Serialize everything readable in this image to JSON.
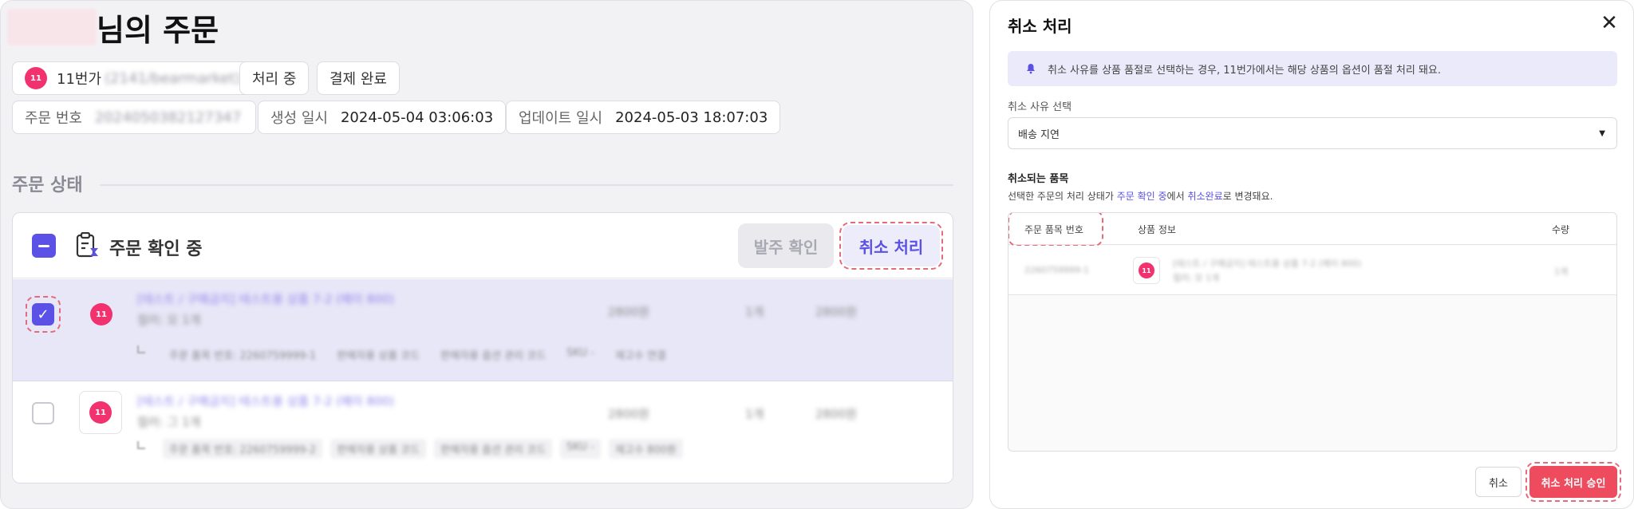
{
  "order_page": {
    "title_suffix": "님의 주문",
    "channel": {
      "name": "11번가",
      "account": "(2141/bearmarket)"
    },
    "status_chips": [
      "처리 중",
      "결제 완료"
    ],
    "order_no": {
      "label": "주문 번호",
      "value": "2024050382127347"
    },
    "created": {
      "label": "생성 일시",
      "value": "2024-05-04 03:06:03"
    },
    "updated": {
      "label": "업데이트 일시",
      "value": "2024-05-03 18:07:03"
    },
    "section_title": "주문 상태",
    "group": {
      "label": "주문 확인 중",
      "confirm_button": "발주 확인",
      "cancel_button": "취소 처리"
    },
    "items": [
      {
        "name": "[테스트 / 구매금지] 테스트용 상품 7-2 (메이 800)",
        "option": "컬러: 모 1개",
        "price": "2800원",
        "qty": "1개",
        "total": "2800원",
        "tags": [
          "주문 품목 번호: 2260759999-1",
          "판매자용 상품 코드",
          "판매자용 옵션 관리 코드",
          "SKU -",
          "재고수 연결"
        ]
      },
      {
        "name": "[테스트 / 구매금지] 테스트용 상품 7-2 (메이 800)",
        "option": "컬러: 그 1개",
        "price": "2800원",
        "qty": "1개",
        "total": "2800원",
        "tags": [
          "주문 품목 번호: 2260759999-2",
          "판매자용 상품 코드",
          "판매자용 옵션 관리 코드",
          "SKU -",
          "재고수 800원"
        ]
      }
    ]
  },
  "modal": {
    "title": "취소 처리",
    "notice": "취소 사유를 상품 품절로 선택하는 경우, 11번가에서는 해당 상품의 옵션이 품절 처리 돼요.",
    "reason_label": "취소 사유 선택",
    "reason_value": "배송 지연",
    "items_title": "취소되는 품목",
    "desc_pre": "선택한 주문의 처리 상태가 ",
    "desc_from": "주문 확인 중",
    "desc_mid": "에서 ",
    "desc_to": "취소완료",
    "desc_post": "로 변경돼요.",
    "columns": [
      "주문 품목 번호",
      "상품 정보",
      "수량"
    ],
    "rows": [
      {
        "item_no": "2260759999-1",
        "info": "[테스트 / 구매금지] 테스트용 상품 7-2 (메이 800)",
        "option": "컬러: 모 1개",
        "qty": "1개"
      }
    ],
    "cancel_button": "취소",
    "approve_button": "취소 처리 승인"
  },
  "colors": {
    "accent": "#5b51e6",
    "danger": "#ef4b5f",
    "brand_11st": "#f2326f"
  }
}
